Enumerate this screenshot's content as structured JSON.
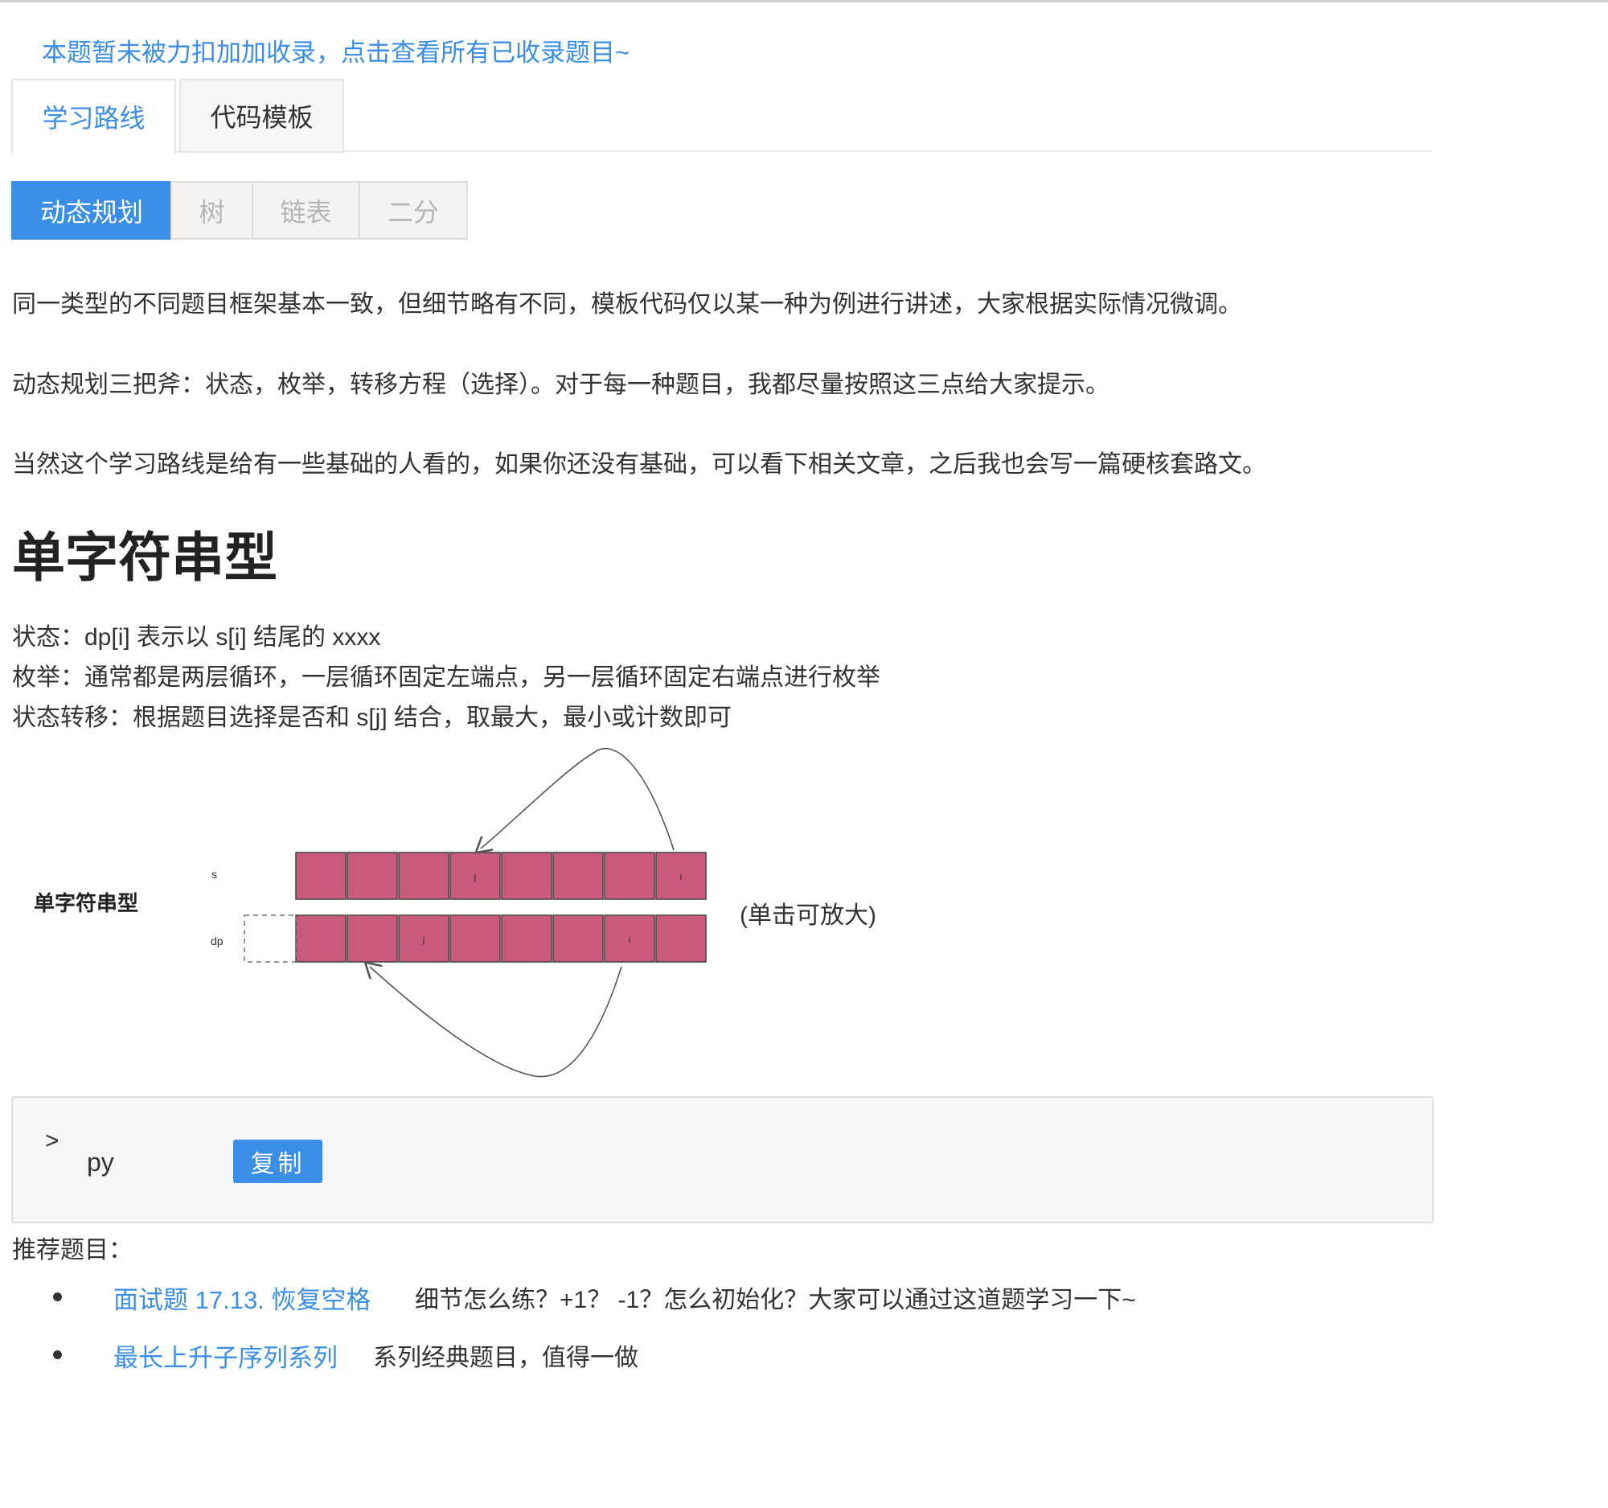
{
  "notice": "本题暂未被力扣加加收录，点击查看所有已收录题目~",
  "main_tabs": [
    {
      "label": "学习路线",
      "active": true
    },
    {
      "label": "代码模板",
      "active": false
    }
  ],
  "sub_tabs": [
    {
      "label": "动态规划",
      "active": true
    },
    {
      "label": "树",
      "active": false
    },
    {
      "label": "链表",
      "active": false
    },
    {
      "label": "二分",
      "active": false
    }
  ],
  "intro": [
    "同一类型的不同题目框架基本一致，但细节略有不同，模板代码仅以某一种为例进行讲述，大家根据实际情况微调。",
    "动态规划三把斧：状态，枚举，转移方程（选择）。对于每一种题目，我都尽量按照这三点给大家提示。",
    "当然这个学习路线是给有一些基础的人看的，如果你还没有基础，可以看下相关文章，之后我也会写一篇硬核套路文。"
  ],
  "section": {
    "title": "单字符串型",
    "lines": [
      "状态：dp[i] 表示以 s[i] 结尾的 xxxx",
      "枚举：通常都是两层循环，一层循环固定左端点，另一层循环固定右端点进行枚举",
      "状态转移：根据题目选择是否和 s[j] 结合，取最大，最小或计数即可"
    ]
  },
  "diagram": {
    "label": "单字符串型",
    "row_s_label": "s",
    "row_dp_label": "dp",
    "cell_j": "j",
    "cell_i": "i",
    "zoom_hint": "(单击可放大)",
    "cell_color": "#c95a7c"
  },
  "code_block": {
    "toggle": ">",
    "lang": "py",
    "copy_label": "复制"
  },
  "recommend": {
    "title": "推荐题目：",
    "items": [
      {
        "link": "面试题 17.13. 恢复空格",
        "desc": "细节怎么练？+1？ -1？怎么初始化？大家可以通过这道题学习一下~"
      },
      {
        "link": "最长上升子序列系列",
        "desc": "系列经典题目，值得一做"
      }
    ]
  },
  "colors": {
    "accent": "#3a8ee6",
    "text": "#333333"
  }
}
